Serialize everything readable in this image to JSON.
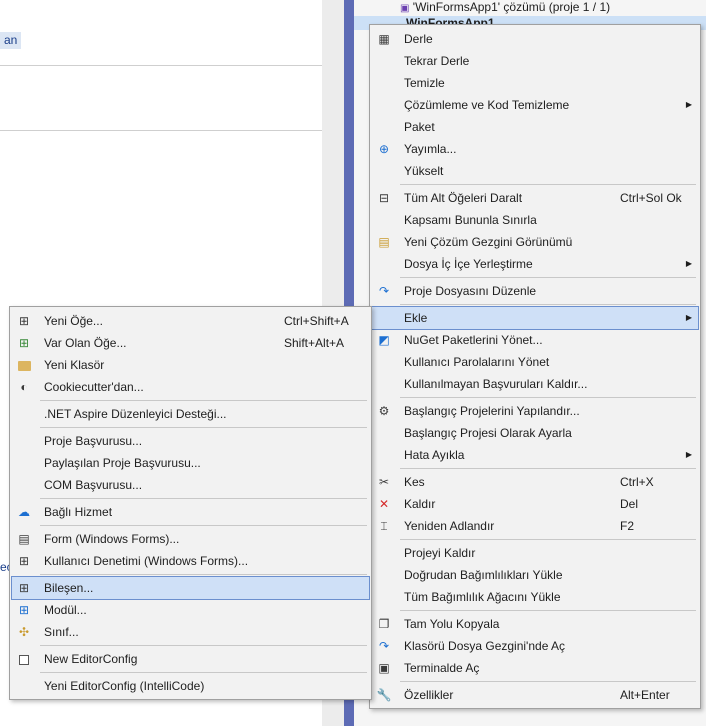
{
  "background": {
    "editor_tag": "an",
    "editor_tag2": "ec",
    "solution_label": "'WinFormsApp1' çözümü (proje 1 / 1)",
    "project_label": "WinFormsApp1"
  },
  "main_menu": {
    "items": [
      {
        "label": "Derle",
        "shortcut": "",
        "submenu": false,
        "icon": "build-icon"
      },
      {
        "label": "Tekrar Derle",
        "shortcut": "",
        "submenu": false,
        "icon": ""
      },
      {
        "label": "Temizle",
        "shortcut": "",
        "submenu": false,
        "icon": ""
      },
      {
        "label": "Çözümleme ve Kod Temizleme",
        "shortcut": "",
        "submenu": true,
        "icon": ""
      },
      {
        "label": "Paket",
        "shortcut": "",
        "submenu": false,
        "icon": ""
      },
      {
        "label": "Yayımla...",
        "shortcut": "",
        "submenu": false,
        "icon": "globe-icon"
      },
      {
        "label": "Yükselt",
        "shortcut": "",
        "submenu": false,
        "icon": ""
      },
      {
        "label": "Tüm Alt Öğeleri Daralt",
        "shortcut": "Ctrl+Sol Ok",
        "submenu": false,
        "icon": "collapse-icon"
      },
      {
        "label": "Kapsamı Bununla Sınırla",
        "shortcut": "",
        "submenu": false,
        "icon": ""
      },
      {
        "label": "Yeni Çözüm Gezgini Görünümü",
        "shortcut": "",
        "submenu": false,
        "icon": "new-view-icon"
      },
      {
        "label": "Dosya İç İçe Yerleştirme",
        "shortcut": "",
        "submenu": true,
        "icon": ""
      },
      {
        "label": "Proje Dosyasını Düzenle",
        "shortcut": "",
        "submenu": false,
        "icon": "edit-project-icon"
      },
      {
        "label": "Ekle",
        "shortcut": "",
        "submenu": true,
        "icon": ""
      },
      {
        "label": "NuGet Paketlerini Yönet...",
        "shortcut": "",
        "submenu": false,
        "icon": "nuget-icon"
      },
      {
        "label": "Kullanıcı Parolalarını Yönet",
        "shortcut": "",
        "submenu": false,
        "icon": ""
      },
      {
        "label": "Kullanılmayan Başvuruları Kaldır...",
        "shortcut": "",
        "submenu": false,
        "icon": ""
      },
      {
        "label": "Başlangıç Projelerini Yapılandır...",
        "shortcut": "",
        "submenu": false,
        "icon": "gear-icon"
      },
      {
        "label": "Başlangıç Projesi Olarak Ayarla",
        "shortcut": "",
        "submenu": false,
        "icon": ""
      },
      {
        "label": "Hata Ayıkla",
        "shortcut": "",
        "submenu": true,
        "icon": ""
      },
      {
        "label": "Kes",
        "shortcut": "Ctrl+X",
        "submenu": false,
        "icon": "scissors-icon"
      },
      {
        "label": "Kaldır",
        "shortcut": "Del",
        "submenu": false,
        "icon": "remove-icon"
      },
      {
        "label": "Yeniden Adlandır",
        "shortcut": "F2",
        "submenu": false,
        "icon": "rename-icon"
      },
      {
        "label": "Projeyi Kaldır",
        "shortcut": "",
        "submenu": false,
        "icon": ""
      },
      {
        "label": "Doğrudan Bağımlılıkları Yükle",
        "shortcut": "",
        "submenu": false,
        "icon": ""
      },
      {
        "label": "Tüm Bağımlılık Ağacını Yükle",
        "shortcut": "",
        "submenu": false,
        "icon": ""
      },
      {
        "label": "Tam Yolu Kopyala",
        "shortcut": "",
        "submenu": false,
        "icon": "copy-icon"
      },
      {
        "label": "Klasörü Dosya Gezgini'nde Aç",
        "shortcut": "",
        "submenu": false,
        "icon": "open-folder-icon"
      },
      {
        "label": "Terminalde Aç",
        "shortcut": "",
        "submenu": false,
        "icon": "terminal-icon"
      },
      {
        "label": "Özellikler",
        "shortcut": "Alt+Enter",
        "submenu": false,
        "icon": "wrench-icon"
      }
    ]
  },
  "add_submenu": {
    "items": [
      {
        "label": "Yeni Öğe...",
        "shortcut": "Ctrl+Shift+A",
        "icon": "new-item-icon"
      },
      {
        "label": "Var Olan Öğe...",
        "shortcut": "Shift+Alt+A",
        "icon": "existing-item-icon"
      },
      {
        "label": "Yeni Klasör",
        "shortcut": "",
        "icon": "folder-icon"
      },
      {
        "label": "Cookiecutter'dan...",
        "shortcut": "",
        "icon": "cookiecutter-icon"
      },
      {
        "label": ".NET Aspire Düzenleyici Desteği...",
        "shortcut": "",
        "icon": ""
      },
      {
        "label": "Proje Başvurusu...",
        "shortcut": "",
        "icon": ""
      },
      {
        "label": "Paylaşılan Proje Başvurusu...",
        "shortcut": "",
        "icon": ""
      },
      {
        "label": "COM Başvurusu...",
        "shortcut": "",
        "icon": ""
      },
      {
        "label": "Bağlı Hizmet",
        "shortcut": "",
        "icon": "connected-service-icon"
      },
      {
        "label": "Form (Windows Forms)...",
        "shortcut": "",
        "icon": "form-icon"
      },
      {
        "label": "Kullanıcı Denetimi (Windows Forms)...",
        "shortcut": "",
        "icon": "user-control-icon"
      },
      {
        "label": "Bileşen...",
        "shortcut": "",
        "icon": "component-icon"
      },
      {
        "label": "Modül...",
        "shortcut": "",
        "icon": "module-icon"
      },
      {
        "label": "Sınıf...",
        "shortcut": "",
        "icon": "class-icon"
      },
      {
        "label": "New EditorConfig",
        "shortcut": "",
        "icon": "file-icon"
      },
      {
        "label": "Yeni EditorConfig (IntelliCode)",
        "shortcut": "",
        "icon": ""
      }
    ]
  }
}
